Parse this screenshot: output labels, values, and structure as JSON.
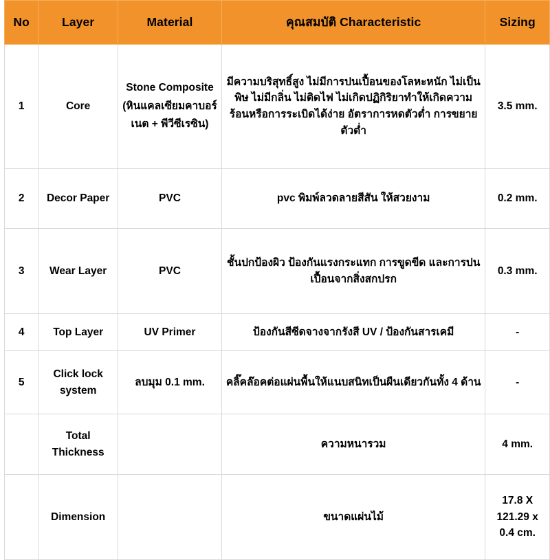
{
  "table": {
    "headers": {
      "no": "No",
      "layer": "Layer",
      "material": "Material",
      "characteristic": "คุณสมบัติ Characteristic",
      "sizing": "Sizing"
    },
    "header_bg_color": "#F2922B",
    "border_color": "#d9d9d9",
    "rows": [
      {
        "no": "1",
        "layer": "Core",
        "material": "Stone Composite (หินแคลเซียมคาบอร์เนต + พีวีซีเรซิน)",
        "characteristic": "มีความบริสุทธิ์สูง ไม่มีการปนเปื้อนของโลหะหนัก ไม่เป็นพิษ ไม่มีกลิ่น ไม่ติดไฟ ไม่เกิดปฏิกิริยาทำให้เกิดความร้อนหรือการระเบิดได้ง่าย อัตราการหดตัวต่ำ การขยายตัวต่ำ",
        "sizing": "3.5 mm."
      },
      {
        "no": "2",
        "layer": "Decor Paper",
        "material": "PVC",
        "characteristic": "pvc พิมพ์ลวดลายสีสัน ให้สวยงาม",
        "sizing": "0.2 mm."
      },
      {
        "no": "3",
        "layer": "Wear Layer",
        "material": "PVC",
        "characteristic": "ชั้นปกป้องผิว ป้องกันแรงกระแทก การขูดขีด และการปนเปื้อนจากสิ่งสกปรก",
        "sizing": "0.3 mm."
      },
      {
        "no": "4",
        "layer": "Top Layer",
        "material": "UV Primer",
        "characteristic": "ป้องกันสีซีดจางจากรังสี UV / ป้องกันสารเคมี",
        "sizing": "-"
      },
      {
        "no": "5",
        "layer": "Click lock system",
        "material": "ลบมุม 0.1 mm.",
        "characteristic": "คลิ๊คล๊อคต่อแผ่นพื้นให้แนบสนิทเป็นผืนเดียวกันทั้ง 4 ด้าน",
        "sizing": "-"
      },
      {
        "no": "",
        "layer": "Total Thickness",
        "material": "",
        "characteristic": "ความหนารวม",
        "sizing": "4 mm."
      },
      {
        "no": "",
        "layer": "Dimension",
        "material": "",
        "characteristic": "ขนาดแผ่นไม้",
        "sizing": "17.8 X 121.29 x 0.4 cm."
      }
    ]
  }
}
